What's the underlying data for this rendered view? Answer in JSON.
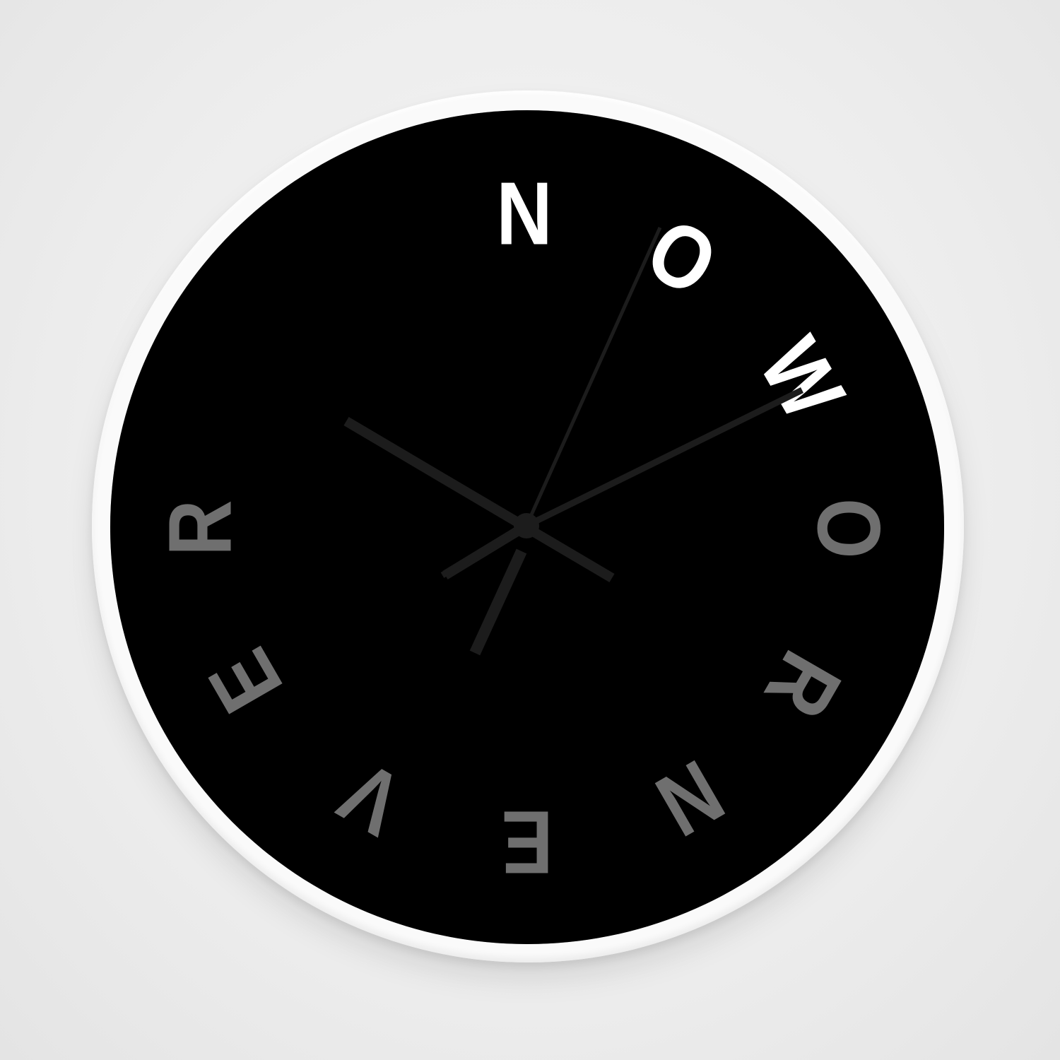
{
  "dial_letters": [
    "N",
    "O",
    "W",
    "O",
    "R",
    "N",
    "E",
    "V",
    "E",
    "R"
  ],
  "colors": {
    "wall": "#ececec",
    "frame": "#ffffff",
    "face": "#000000",
    "letters_now": "#ffffff",
    "letters_rest": "#6f6f6f",
    "hands": "#1c1c1c"
  },
  "time_shown": {
    "hour_hand_points_to": "about 10",
    "minute_hand_points_to": "about 12 min",
    "second_hand_points_to": "about 4 sec"
  }
}
